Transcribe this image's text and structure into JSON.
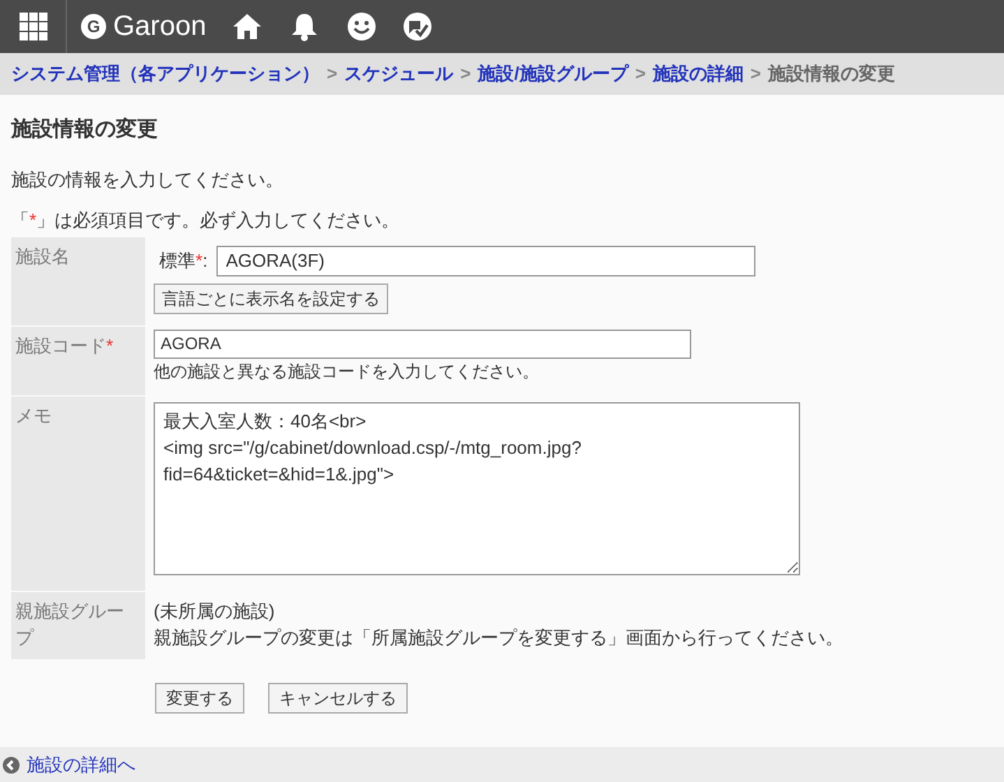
{
  "header": {
    "logo": "Garoon",
    "logo_letter": "G"
  },
  "breadcrumb": {
    "links": [
      "システム管理（各アプリケーション）",
      "スケジュール",
      "施設/施設グループ",
      "施設の詳細"
    ],
    "separator": ">",
    "current": "施設情報の変更"
  },
  "page_title": "施設情報の変更",
  "intro": "施設の情報を入力してください。",
  "required_note": {
    "open": "「",
    "mark": "*",
    "close": "」は必須項目です。必ず入力してください。"
  },
  "form": {
    "name": {
      "label": "施設名",
      "sub_label": "標準",
      "mark": "*",
      "colon": ":",
      "value": "AGORA(3F)",
      "button": "言語ごとに表示名を設定する"
    },
    "code": {
      "label": "施設コード",
      "mark": "*",
      "value": "AGORA",
      "hint": "他の施設と異なる施設コードを入力してください。"
    },
    "memo": {
      "label": "メモ",
      "value": "最大入室人数：40名<br>\n<img src=\"/g/cabinet/download.csp/-/mtg_room.jpg?fid=64&ticket=&hid=1&.jpg\">"
    },
    "parent": {
      "label": "親施設グループ",
      "value": "(未所属の施設)",
      "note": "親施設グループの変更は「所属施設グループを変更する」画面から行ってください。"
    }
  },
  "buttons": [
    "変更する",
    "キャンセルする"
  ],
  "footer_link": "施設の詳細へ"
}
